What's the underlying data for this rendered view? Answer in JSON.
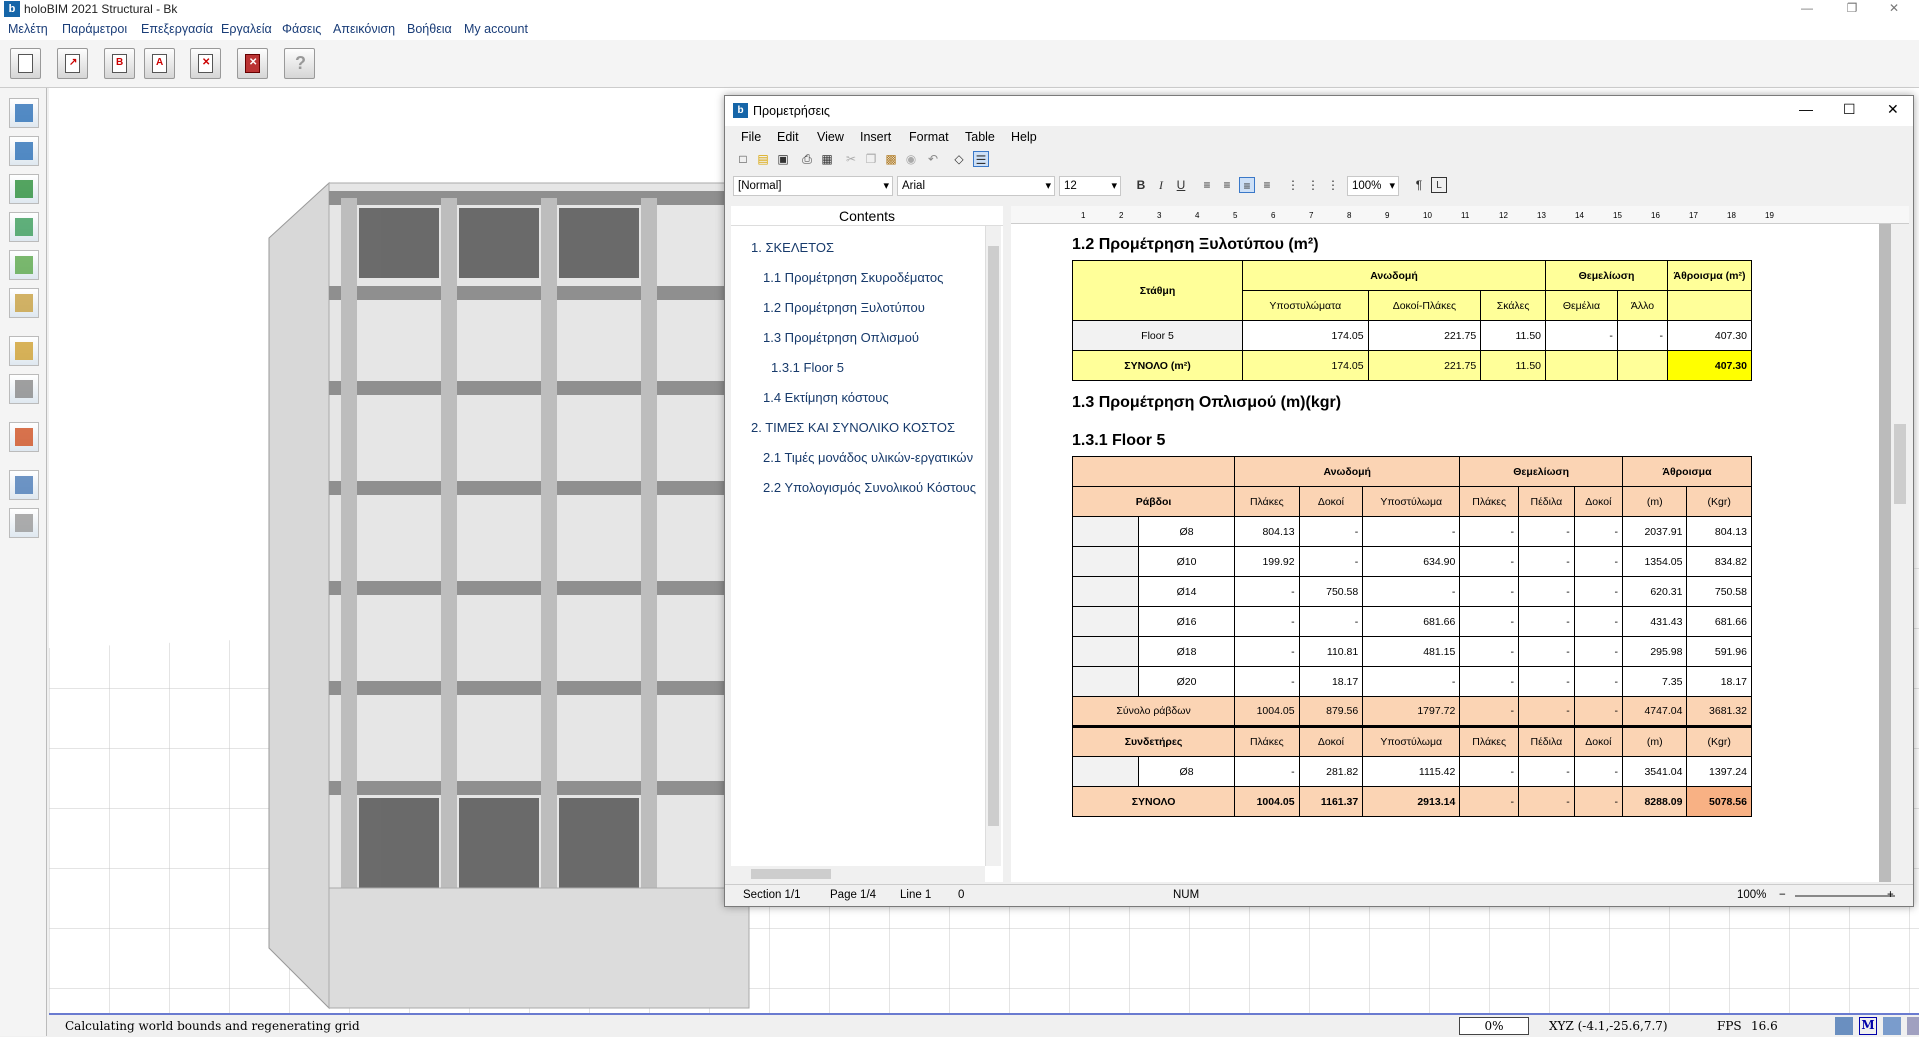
{
  "app": {
    "title": "holoBIM 2021 Structural - Bk",
    "logo": "b",
    "menu": [
      "Μελέτη",
      "Παράμετροι",
      "Επεξεργασία",
      "Εργαλεία",
      "Φάσεις",
      "Απεικόνιση",
      "Βοήθεια",
      "My account"
    ]
  },
  "toolbar_icons": [
    "new-document-icon",
    "export-icon",
    "report-b-icon",
    "report-a-icon",
    "delete-document-icon",
    "close-icon",
    "help-icon"
  ],
  "left_tools": [
    "structure-icon",
    "sum-icon",
    "check-icon",
    "layers-icon",
    "settings-icon",
    "print-icon",
    "measure-icon",
    "export-icon",
    "globe-icon",
    "grid-icon",
    "printer-icon"
  ],
  "status": {
    "message": "Calculating world bounds and regenerating grid",
    "progress": "0%",
    "coords": "XYZ (-4.1,-25.6,7.7)",
    "fps_label": "FPS",
    "fps": "16.6"
  },
  "dialog": {
    "title": "Προμετρήσεις",
    "menu": [
      "File",
      "Edit",
      "View",
      "Insert",
      "Format",
      "Table",
      "Help"
    ],
    "style_combo": "[Normal]",
    "font_combo": "Arial",
    "size_combo": "12",
    "zoom_combo": "100%",
    "contents_title": "Contents",
    "contents": [
      {
        "label": "1. ΣΚΕΛΕΤΟΣ",
        "level": 0
      },
      {
        "label": "1.1 Προμέτρηση Σκυροδέματος",
        "level": 1
      },
      {
        "label": "1.2 Προμέτρηση Ξυλοτύπου",
        "level": 1
      },
      {
        "label": "1.3 Προμέτρηση Οπλισμού",
        "level": 1
      },
      {
        "label": "1.3.1 Floor 5",
        "level": 2
      },
      {
        "label": "1.4 Εκτίμηση κόστους",
        "level": 1
      },
      {
        "label": "2. ΤΙΜΕΣ ΚΑΙ ΣΥΝΟΛΙΚΟ ΚΟΣΤΟΣ",
        "level": 0
      },
      {
        "label": "2.1 Τιμές μονάδος υλικών-εργατικών",
        "level": 1
      },
      {
        "label": "2.2 Υπολογισμός Συνολικού Κόστους",
        "level": 1
      }
    ],
    "ruler_marks": [
      "1",
      "2",
      "3",
      "4",
      "5",
      "6",
      "7",
      "8",
      "9",
      "10",
      "11",
      "12",
      "13",
      "14",
      "15",
      "16",
      "17",
      "18",
      "19"
    ],
    "statusbar": {
      "section": "Section 1/1",
      "page": "Page 1/4",
      "line": "Line 1",
      "col": "0",
      "num": "NUM",
      "zoom": "100%"
    }
  },
  "doc": {
    "h12": "1.2 Προμέτρηση Ξυλοτύπου (m²)",
    "t12": {
      "h_stathmi": "Στάθμη",
      "h_anodomi": "Ανωδομή",
      "h_themeliosi": "Θεμελίωση",
      "h_athroisma": "Άθροισμα (m²)",
      "sub": [
        "Υποστυλώματα",
        "Δοκοί-Πλάκες",
        "Σκάλες",
        "Θεμέλια",
        "Άλλο"
      ],
      "rows": [
        {
          "name": "Floor 5",
          "v": [
            "174.05",
            "221.75",
            "11.50",
            "-",
            "-",
            "407.30"
          ]
        },
        {
          "name": "ΣΥΝΟΛΟ (m²)",
          "v": [
            "174.05",
            "221.75",
            "11.50",
            "",
            "",
            "407.30"
          ]
        }
      ]
    },
    "h13": "1.3 Προμέτρηση Οπλισμού (m)(kgr)",
    "h131": "1.3.1 Floor 5",
    "t13": {
      "h_anodomi": "Ανωδομή",
      "h_themeliosi": "Θεμελίωση",
      "h_athroisma": "Άθροισμα",
      "h_rabdoi": "Ράβδοι",
      "sub": [
        "Πλάκες",
        "Δοκοί",
        "Υποστύλωμα",
        "Πλάκες",
        "Πέδιλα",
        "Δοκοί",
        "(m)",
        "(Kgr)"
      ],
      "rows": [
        {
          "name": "Ø8",
          "v": [
            "804.13",
            "-",
            "-",
            "-",
            "-",
            "-",
            "2037.91",
            "804.13"
          ]
        },
        {
          "name": "Ø10",
          "v": [
            "199.92",
            "-",
            "634.90",
            "-",
            "-",
            "-",
            "1354.05",
            "834.82"
          ]
        },
        {
          "name": "Ø14",
          "v": [
            "-",
            "750.58",
            "-",
            "-",
            "-",
            "-",
            "620.31",
            "750.58"
          ]
        },
        {
          "name": "Ø16",
          "v": [
            "-",
            "-",
            "681.66",
            "-",
            "-",
            "-",
            "431.43",
            "681.66"
          ]
        },
        {
          "name": "Ø18",
          "v": [
            "-",
            "110.81",
            "481.15",
            "-",
            "-",
            "-",
            "295.98",
            "591.96"
          ]
        },
        {
          "name": "Ø20",
          "v": [
            "-",
            "18.17",
            "-",
            "-",
            "-",
            "-",
            "7.35",
            "18.17"
          ]
        }
      ],
      "subtotal": {
        "name": "Σύνολο ράβδων",
        "v": [
          "1004.05",
          "879.56",
          "1797.72",
          "-",
          "-",
          "-",
          "4747.04",
          "3681.32"
        ]
      },
      "h_sindetires": "Συνδετήρες",
      "sind_row": {
        "name": "Ø8",
        "v": [
          "-",
          "281.82",
          "1115.42",
          "-",
          "-",
          "-",
          "3541.04",
          "1397.24"
        ]
      },
      "total": {
        "name": "ΣΥΝΟΛΟ",
        "v": [
          "1004.05",
          "1161.37",
          "2913.14",
          "-",
          "-",
          "-",
          "8288.09",
          "5078.56"
        ]
      }
    }
  }
}
